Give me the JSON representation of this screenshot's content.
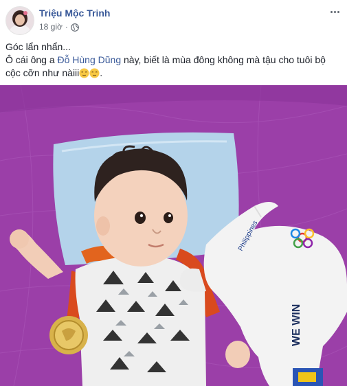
{
  "post": {
    "author": "Triệu Mộc Trinh",
    "time": "18 giờ",
    "separator": "·",
    "privacy_icon": "globe-icon",
    "more_icon": "more-options-icon",
    "text": {
      "line1": "Góc lẩn nhẩn...",
      "line2_before": "Ô cái ông a ",
      "mention": "Đỗ Hùng Dũng",
      "line2_after": " này, biết là mùa đông không mà tậu cho tuôi bộ cộc cỡn như nàiii",
      "line2_end": ".",
      "emoji_icons": [
        "relieved-face-icon",
        "relieved-face-icon"
      ]
    },
    "photo": {
      "plush_text_1": "Philippines",
      "plush_text_2": "WE WIN",
      "colors": {
        "blanket": "#9b3fa8",
        "pillow": "#b4d3ea",
        "medal": "#d8b24a"
      }
    }
  }
}
